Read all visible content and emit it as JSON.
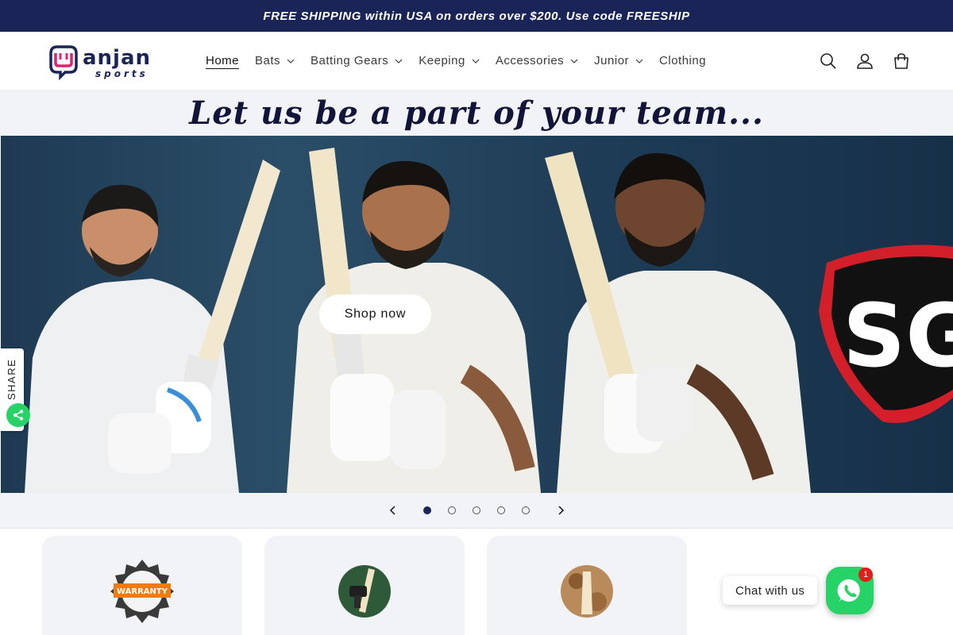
{
  "announcement": {
    "text": "FREE SHIPPING within USA on orders over $200. Use code FREESHIP"
  },
  "header": {
    "logo_text": "anjan sports",
    "nav": [
      {
        "label": "Home",
        "active": true,
        "dropdown": false
      },
      {
        "label": "Bats",
        "active": false,
        "dropdown": true
      },
      {
        "label": "Batting Gears",
        "active": false,
        "dropdown": true
      },
      {
        "label": "Keeping",
        "active": false,
        "dropdown": true
      },
      {
        "label": "Accessories",
        "active": false,
        "dropdown": true
      },
      {
        "label": "Junior",
        "active": false,
        "dropdown": true
      },
      {
        "label": "Clothing",
        "active": false,
        "dropdown": false
      }
    ],
    "icons": [
      "search-icon",
      "account-icon",
      "cart-icon"
    ]
  },
  "tagline": {
    "text": "Let us be a part of your team..."
  },
  "hero": {
    "button_label": "Shop now",
    "brand_badge": "SG"
  },
  "slider": {
    "prev_icon": "chevron-left-icon",
    "next_icon": "chevron-right-icon",
    "slide_count": 5,
    "active_index": 0
  },
  "cards": [
    {
      "icon": "warranty-badge-icon",
      "badge_text": "WARRANTY"
    },
    {
      "icon": "bat-service-icon"
    },
    {
      "icon": "bat-knocking-icon"
    }
  ],
  "share": {
    "label": "SHARE"
  },
  "chat": {
    "label": "Chat with us",
    "badge_count": "1"
  },
  "colors": {
    "brand_navy": "#1b2457",
    "whatsapp_green": "#25d366",
    "badge_red": "#e31b1b",
    "band_bg": "#f2f3f7"
  }
}
